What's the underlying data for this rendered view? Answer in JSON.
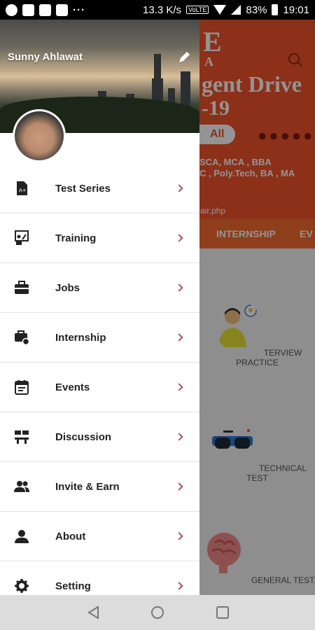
{
  "status_bar": {
    "speed": "13.3 K/s",
    "volte": "VoLTE",
    "battery": "83%",
    "time": "19:01"
  },
  "background": {
    "banner": {
      "big_letter": "E",
      "small_a": "A",
      "headline": "gent Drive",
      "year": "-19",
      "all_badge": "All",
      "line1": "SCA, MCA , BBA",
      "line2": "C , Poly.Tech, BA , MA",
      "url": "air.php"
    },
    "tabs": [
      "INTERNSHIP",
      "EV"
    ],
    "cards": [
      "TERVIEW PRACTICE",
      "TECHNICAL TEST",
      "GENERAL TEST"
    ]
  },
  "drawer": {
    "user_name": "Sunny Ahlawat",
    "items": [
      {
        "label": "Test Series",
        "icon": "test-series-icon"
      },
      {
        "label": "Training",
        "icon": "training-icon"
      },
      {
        "label": "Jobs",
        "icon": "briefcase-icon"
      },
      {
        "label": "Internship",
        "icon": "internship-icon"
      },
      {
        "label": "Events",
        "icon": "calendar-icon"
      },
      {
        "label": "Discussion",
        "icon": "discussion-icon"
      },
      {
        "label": "Invite & Earn",
        "icon": "group-icon"
      },
      {
        "label": "About",
        "icon": "person-icon"
      },
      {
        "label": "Setting",
        "icon": "gear-icon"
      }
    ]
  },
  "colors": {
    "banner": "#f2542b",
    "tabbar": "#f46b2e",
    "accent": "#a55"
  }
}
